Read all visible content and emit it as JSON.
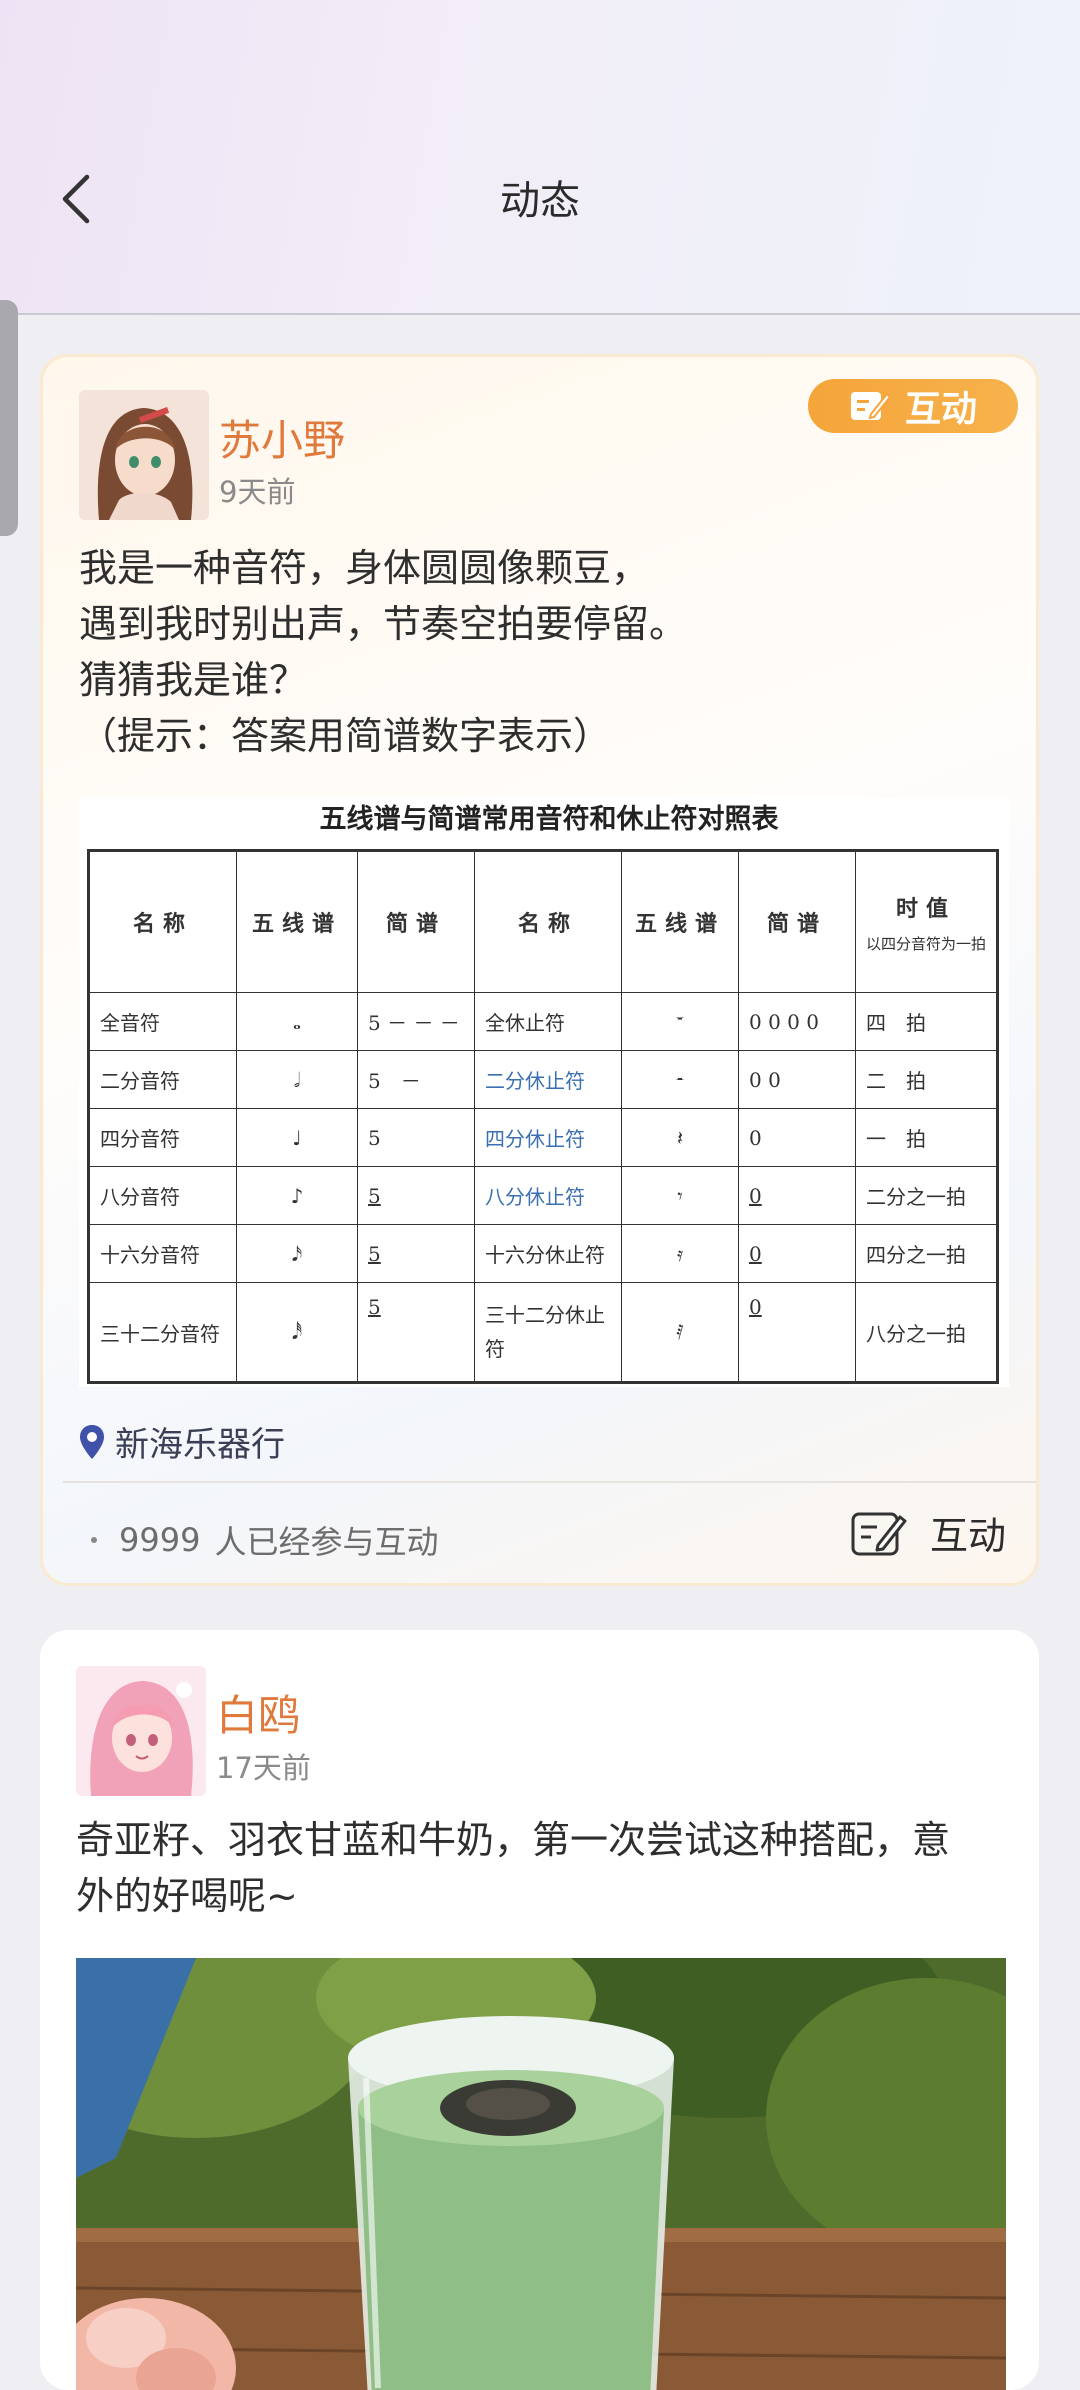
{
  "header": {
    "title": "动态",
    "back_icon": "chevron-left-icon"
  },
  "posts": [
    {
      "user": "苏小野",
      "time": "9天前",
      "badge": "互动",
      "lines": [
        "我是一种音符，身体圆圆像颗豆，",
        "遇到我时别出声，节奏空拍要停留。",
        "猜猜我是谁？",
        "（提示：答案用简谱数字表示）"
      ],
      "table": {
        "title": "五线谱与简谱常用音符和休止符对照表",
        "headers": [
          "名称",
          "五线谱",
          "简谱",
          "名称",
          "五线谱",
          "简谱",
          "时值"
        ],
        "header_note": "以四分音符为一拍",
        "rows": [
          [
            "全音符",
            "𝅝",
            "5 － － －",
            "全休止符",
            "𝄻",
            "0 0 0 0",
            "四　拍"
          ],
          [
            "二分音符",
            "𝅗𝅥",
            "5　－",
            "二分休止符",
            "𝄼",
            "0 0",
            "二　拍"
          ],
          [
            "四分音符",
            "♩",
            "5",
            "四分休止符",
            "𝄽",
            "0",
            "一　拍"
          ],
          [
            "八分音符",
            "♪",
            "5",
            "八分休止符",
            "𝄾",
            "0",
            "二分之一拍"
          ],
          [
            "十六分音符",
            "𝅘𝅥𝅯",
            "5",
            "十六分休止符",
            "𝄿",
            "0",
            "四分之一拍"
          ],
          [
            "三十二分音符",
            "𝅘𝅥𝅰",
            "5",
            "三十二分休止符",
            "𝅀",
            "0",
            "八分之一拍"
          ]
        ]
      },
      "location": "新海乐器行",
      "participants_count": "9999",
      "participants_text": "人已经参与互动",
      "interact_label": "互动"
    },
    {
      "user": "白鸥",
      "time": "17天前",
      "lines": [
        "奇亚籽、羽衣甘蓝和牛奶，第一次尝试这种搭配，意",
        "外的好喝呢~"
      ],
      "photo": "green-smoothie-photo"
    }
  ]
}
